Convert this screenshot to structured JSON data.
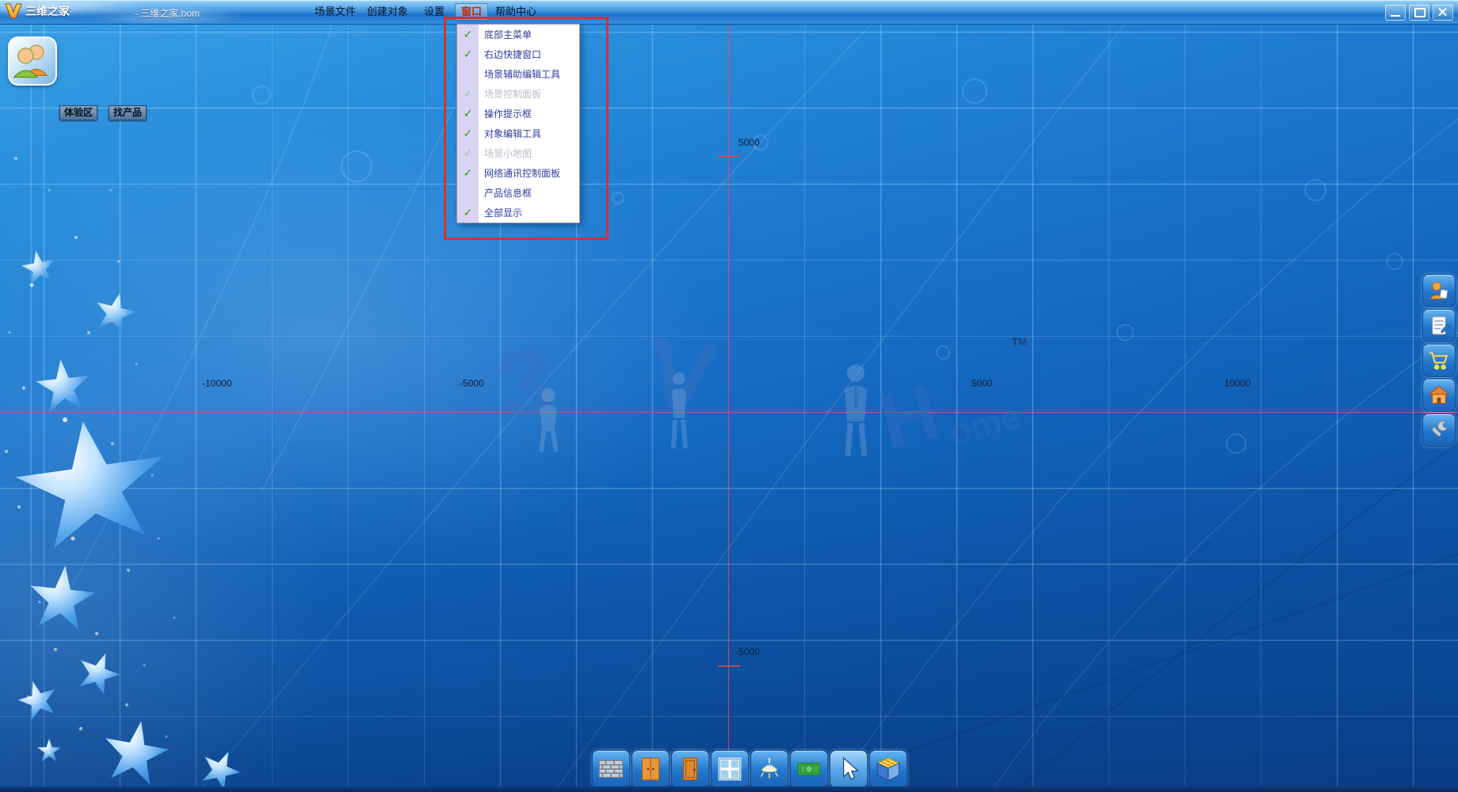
{
  "window": {
    "app_name": "三维之家",
    "file_title": "- 三维之家.hom"
  },
  "menubar": {
    "items": [
      {
        "label": "场景文件"
      },
      {
        "label": "创建对象"
      },
      {
        "label": "设置"
      },
      {
        "label": "窗口"
      },
      {
        "label": "帮助中心"
      }
    ],
    "active_item": "窗口"
  },
  "window_menu": {
    "checkmark": "✓",
    "items": [
      {
        "label": "底部主菜单",
        "checked": true,
        "enabled": true
      },
      {
        "label": "右边快捷窗口",
        "checked": true,
        "enabled": true
      },
      {
        "label": "场景辅助编辑工具",
        "checked": false,
        "enabled": true
      },
      {
        "label": "场景控制面板",
        "checked": true,
        "enabled": false
      },
      {
        "label": "操作提示框",
        "checked": true,
        "enabled": true
      },
      {
        "label": "对象编辑工具",
        "checked": true,
        "enabled": true
      },
      {
        "label": "场景小地图",
        "checked": true,
        "enabled": false
      },
      {
        "label": "网络通讯控制面板",
        "checked": true,
        "enabled": true
      },
      {
        "label": "产品信息框",
        "checked": false,
        "enabled": true
      },
      {
        "label": "全部显示",
        "checked": true,
        "enabled": true
      }
    ]
  },
  "side_tabs": {
    "experience": "体验区",
    "find_product": "找产品"
  },
  "canvas": {
    "x_axis_labels": [
      "-10000",
      "-5000",
      "5000",
      "10000"
    ],
    "y_axis_labels": [
      "5000",
      "-5000"
    ],
    "watermark": {
      "ch1": "3",
      "ch2": "V",
      "ch3": "H",
      "ch4": "ome",
      "tm": "TM"
    }
  },
  "right_toolbar": [
    "customer",
    "document",
    "cart",
    "home",
    "wrench"
  ],
  "bottom_toolbar": [
    "wall",
    "cabinet",
    "door",
    "window",
    "light",
    "money",
    "pointer",
    "cube"
  ],
  "colors": {
    "annotation_red": "#d83030",
    "check_green": "#21a321",
    "axis_red": "#e24848",
    "titlebar_blue": "#2e8fd8",
    "menu_item_blue": "#2b3d9e"
  }
}
